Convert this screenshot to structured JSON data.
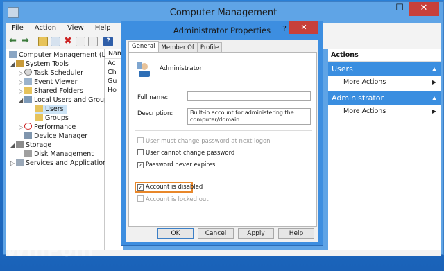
{
  "window": {
    "title": "Computer Management"
  },
  "menu": [
    "File",
    "Action",
    "View",
    "Help"
  ],
  "tree": [
    {
      "label": "Computer Management (Local)",
      "indent": 0,
      "arrow": ""
    },
    {
      "label": "System Tools",
      "indent": 1,
      "arrow": "◢"
    },
    {
      "label": "Task Scheduler",
      "indent": 2,
      "arrow": "▷"
    },
    {
      "label": "Event Viewer",
      "indent": 2,
      "arrow": "▷"
    },
    {
      "label": "Shared Folders",
      "indent": 2,
      "arrow": "▷"
    },
    {
      "label": "Local Users and Groups",
      "indent": 2,
      "arrow": "◢"
    },
    {
      "label": "Users",
      "indent": 3,
      "arrow": ""
    },
    {
      "label": "Groups",
      "indent": 3,
      "arrow": ""
    },
    {
      "label": "Performance",
      "indent": 2,
      "arrow": "▷"
    },
    {
      "label": "Device Manager",
      "indent": 2,
      "arrow": ""
    },
    {
      "label": "Storage",
      "indent": 1,
      "arrow": "◢"
    },
    {
      "label": "Disk Management",
      "indent": 2,
      "arrow": ""
    },
    {
      "label": "Services and Applications",
      "indent": 1,
      "arrow": "▷"
    }
  ],
  "list": {
    "header": "Name",
    "items": [
      "Ac",
      "Ch",
      "Gu",
      "Ho"
    ]
  },
  "actions": {
    "header": "Actions",
    "sections": [
      {
        "title": "Users",
        "link": "More Actions"
      },
      {
        "title": "Administrator",
        "link": "More Actions"
      }
    ]
  },
  "dialog": {
    "title": "Administrator Properties",
    "help": "?",
    "tabs": [
      "General",
      "Member Of",
      "Profile"
    ],
    "username": "Administrator",
    "full_name_label": "Full name:",
    "full_name_value": "",
    "description_label": "Description:",
    "description_value": "Built-in account for administering the computer/domain",
    "checkboxes": [
      {
        "label": "User must change password at next logon",
        "checked": false,
        "disabled": true
      },
      {
        "label": "User cannot change password",
        "checked": false,
        "disabled": false
      },
      {
        "label": "Password never expires",
        "checked": true,
        "disabled": false
      },
      {
        "label": "Account is disabled",
        "checked": true,
        "disabled": false
      },
      {
        "label": "Account is locked out",
        "checked": false,
        "disabled": true
      }
    ],
    "buttons": {
      "ok": "OK",
      "cancel": "Cancel",
      "apply": "Apply",
      "help": "Help"
    }
  },
  "watermark": "WinPoin"
}
